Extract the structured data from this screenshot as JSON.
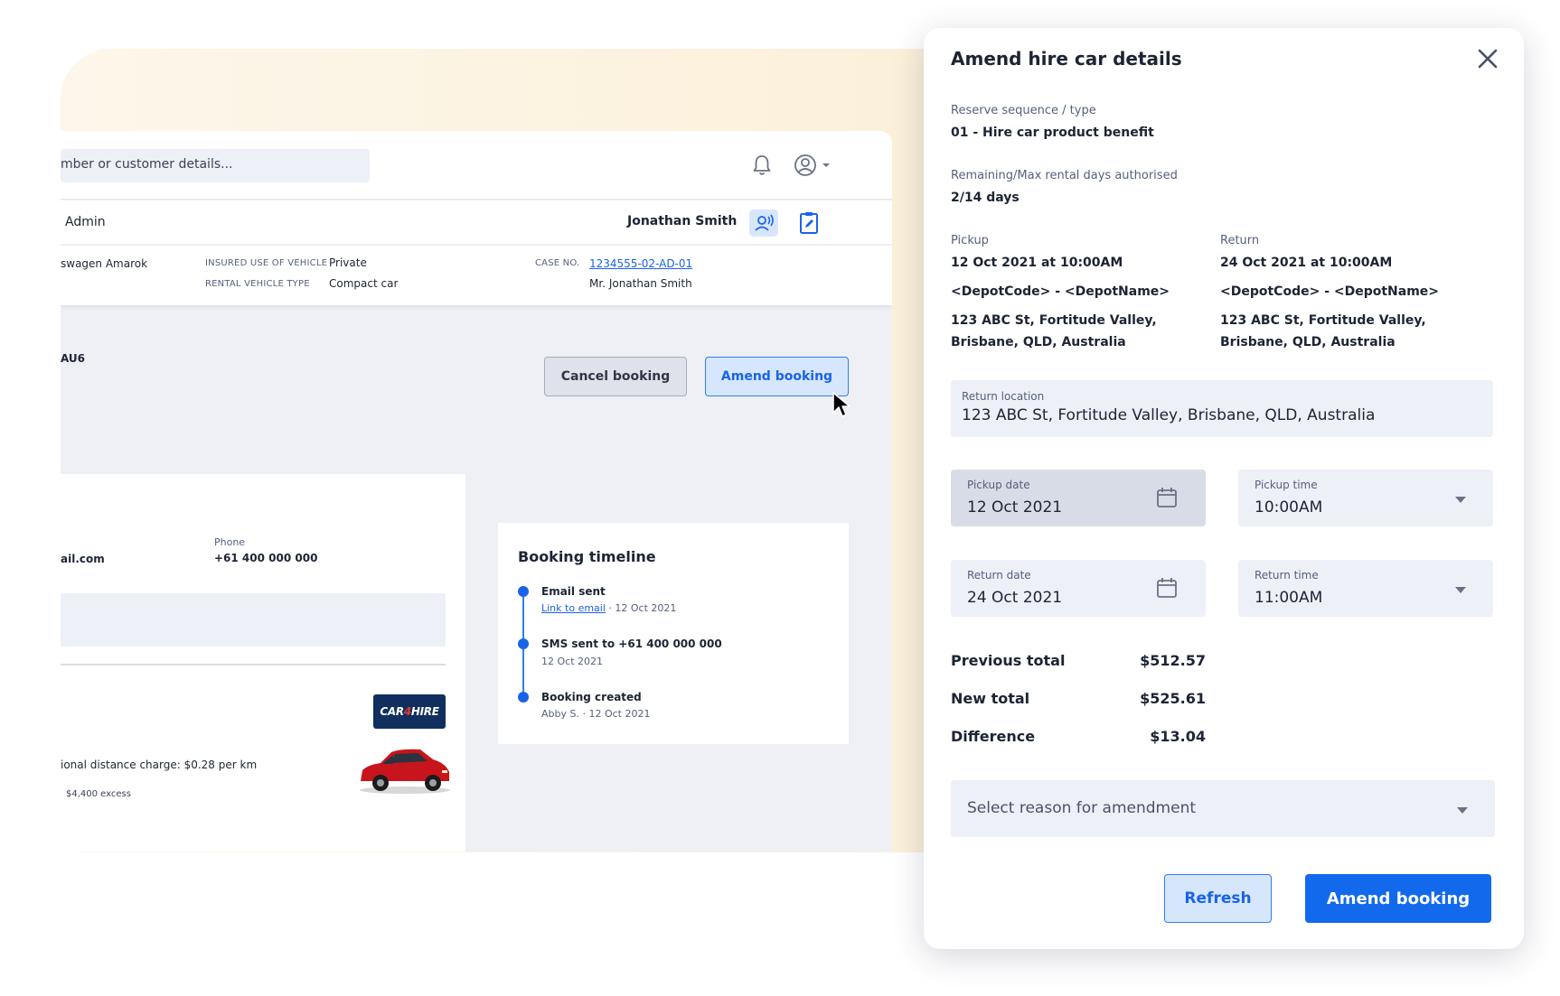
{
  "background": {
    "topbar": {
      "search_text": "mber or customer details..."
    },
    "subbar": {
      "role": "Admin",
      "user_name": "Jonathan Smith"
    },
    "info": {
      "vehicle": "swagen Amarok",
      "insured_use_label": "INSURED USE OF VEHICLE",
      "insured_use_value": "Private",
      "rental_type_label": "RENTAL VEHICLE TYPE",
      "rental_type_value": "Compact car",
      "case_no_label": "CASE NO.",
      "case_no_value": "1234555-02-AD-01",
      "customer_name": "Mr. Jonathan Smith"
    },
    "rego": "AU6",
    "actions": {
      "cancel": "Cancel booking",
      "amend": "Amend booking"
    },
    "customer": {
      "email": "ail.com",
      "phone_label": "Phone",
      "phone_value": "+61 400 000 000",
      "provider_logo_a": "CAR",
      "provider_logo_b": "4",
      "provider_logo_c": "HIRE",
      "distance_charge": "ional distance charge: $0.28 per km",
      "excess": "$4,400 excess"
    },
    "timeline": {
      "title": "Booking timeline",
      "events": [
        {
          "title": "Email sent",
          "link": "Link to email",
          "sub": " · 12 Oct 2021"
        },
        {
          "title": "SMS sent to +61 400 000 000",
          "sub": "12 Oct 2021"
        },
        {
          "title": "Booking created",
          "sub": "Abby S. · 12 Oct 2021"
        }
      ]
    }
  },
  "modal": {
    "title": "Amend hire car details",
    "reserve_label": "Reserve sequence / type",
    "reserve_value": "01 - Hire car product benefit",
    "days_label": "Remaining/Max rental days authorised",
    "days_value": "2/14 days",
    "pickup": {
      "label": "Pickup",
      "datetime": "12 Oct 2021 at 10:00AM",
      "depot": "<DepotCode> - <DepotName>",
      "address_line1": "123 ABC St, Fortitude Valley,",
      "address_line2": "Brisbane, QLD, Australia"
    },
    "return": {
      "label": "Return",
      "datetime": "24 Oct 2021 at 10:00AM",
      "depot": "<DepotCode> - <DepotName>",
      "address_line1": "123 ABC St, Fortitude Valley,",
      "address_line2": "Brisbane, QLD, Australia"
    },
    "return_location": {
      "label": "Return location",
      "value": "123 ABC St, Fortitude Valley, Brisbane, QLD, Australia"
    },
    "pickup_date": {
      "label": "Pickup date",
      "value": "12 Oct 2021"
    },
    "pickup_time": {
      "label": "Pickup time",
      "value": "10:00AM"
    },
    "return_date": {
      "label": "Return date",
      "value": "24 Oct 2021"
    },
    "return_time": {
      "label": "Return time",
      "value": "11:00AM"
    },
    "totals": {
      "previous_label": "Previous total",
      "previous_value": "$512.57",
      "new_label": "New total",
      "new_value": "$525.61",
      "difference_label": "Difference",
      "difference_value": "$13.04"
    },
    "reason_placeholder": "Select reason for amendment",
    "refresh_label": "Refresh",
    "amend_label": "Amend booking"
  },
  "colors": {
    "accent": "#1369ec",
    "accent_light": "#d6e6fd",
    "field_bg": "#eef0f8",
    "cream": "#fbf0d9"
  }
}
